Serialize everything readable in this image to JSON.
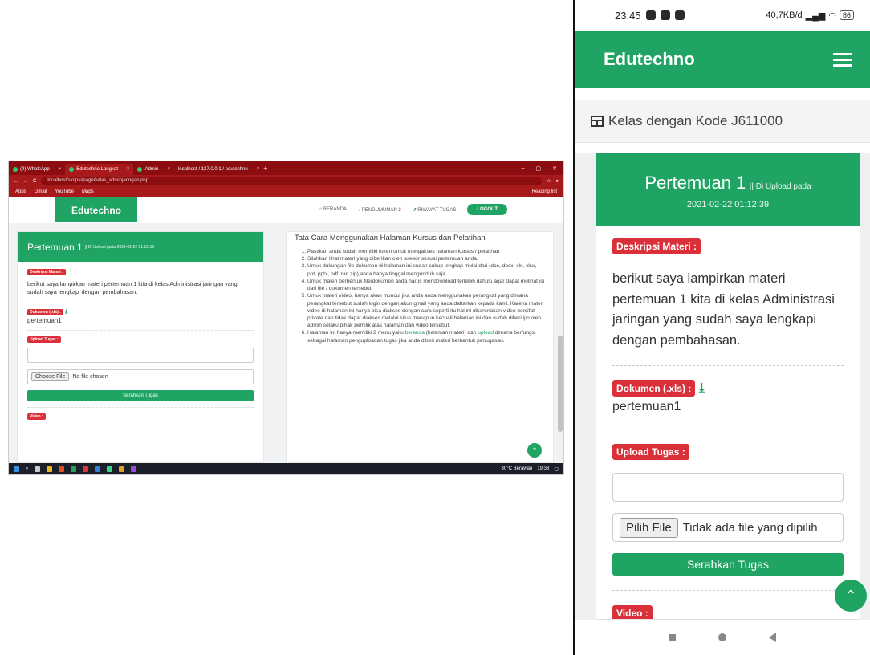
{
  "desktop": {
    "browser": {
      "tabs": [
        {
          "label": "(9) WhatsApp"
        },
        {
          "label": "Edutechno Langkat"
        },
        {
          "label": "Admin"
        },
        {
          "label": "localhost / 127.0.0.1 / edutechno"
        }
      ],
      "url": "localhost/skripsi/page/kelas_adminjaringan.php",
      "bookmarks": [
        "Apps",
        "Gmail",
        "YouTube",
        "Maps"
      ],
      "reading_list": "Reading list"
    },
    "nav": {
      "brand": "Edutechno",
      "beranda": "BERANDA",
      "pengumuman": "PENGUMUMAN",
      "pengumuman_count": "3",
      "riwayat": "RIWAYAT TUGAS",
      "logout": "LOGOUT"
    },
    "card": {
      "title": "Pertemuan 1",
      "uploaded": "|| Di Upload pada 2021-02-22 01:12:39",
      "deskripsi_label": "Deskripsi Materi :",
      "deskripsi_text": "berikut saya lampirkan materi pertemuan 1 kita di kelas Administrasi jaringan yang sudah saya lengkapi dengan pembahasan.",
      "dokumen_label": "Dokumen (.xls) :",
      "dokumen_value": "pertemuan1",
      "upload_label": "Upload Tugas :",
      "choose_file": "Choose File",
      "no_file": "No file chosen",
      "submit": "Serahkan Tugas",
      "video_label": "Video :"
    },
    "panel": {
      "title": "Tata Cara Menggunakan Halaman Kursus dan Pelatihan",
      "items": [
        "Pastikan anda sudah memiliki token untuk mengakses halaman kursus / pelatihan",
        "Silahkan lihat materi yang diberikan oleh asesor sesuai pertemuan anda.",
        "Untuk dukungan file dokumen di halaman ini sudah cukup lengkap mulai dari (doc, docx, xls, xlsx, ppt, pptx, pdf, rar, zip),anda hanya tinggal mengunduh saja.",
        "Untuk materi berbentuk file/dokumen anda harus mendownload terlebih dahulu agar dapat melihat isi dari file / dokumen tersebut.",
        "Untuk materi video, hanya akan muncul jika anda anda menggunakan perangkat yang dimana perangkat tersebut sudah login dengan akun gmail yang anda daftarkan kepada kami. Karena materi video di halaman ini hanya bisa diakses dengan cara seperti itu hal ini dikarenakan video bersifat private dan tidak dapat diakses melalui situs manapun kecuali halaman ini dan sudah diberi ijin oleh admin selaku pihak pemilik atas halaman dan video tersebut."
      ],
      "item6_pre": "Halaman ini hanya memiliki 2 menu yaitu ",
      "item6_link1": "beranda",
      "item6_mid": " (halaman materi) dan ",
      "item6_link2": "upload",
      "item6_post": " dimana berfungsi sebagai halaman penguploadan tugas jika anda diberi materi berbentuk penugasan."
    },
    "taskbar": {
      "weather": "30°C Berawan",
      "time": "19:38"
    }
  },
  "mobile": {
    "status": {
      "time": "23:45",
      "speed": "40,7KB/d",
      "battery": "86"
    },
    "brand": "Edutechno",
    "breadcrumb": "Kelas dengan Kode J611000",
    "card": {
      "title": "Pertemuan 1",
      "uploaded": "|| Di Upload pada",
      "date": "2021-02-22 01:12:39",
      "deskripsi_label": "Deskripsi Materi :",
      "deskripsi_text": "berikut saya lampirkan materi pertemuan 1 kita di kelas Administrasi jaringan yang sudah saya lengkapi dengan pembahasan.",
      "dokumen_label": "Dokumen (.xls) :",
      "dokumen_value": "pertemuan1",
      "upload_label": "Upload Tugas :",
      "choose_file": "Pilih File",
      "no_file": "Tidak ada file yang dipilih",
      "submit": "Serahkan Tugas",
      "video_label": "Video :"
    }
  },
  "colors": {
    "brand_green": "#1fa463",
    "tag_red": "#d9303a",
    "browser_red": "#a8191c"
  }
}
